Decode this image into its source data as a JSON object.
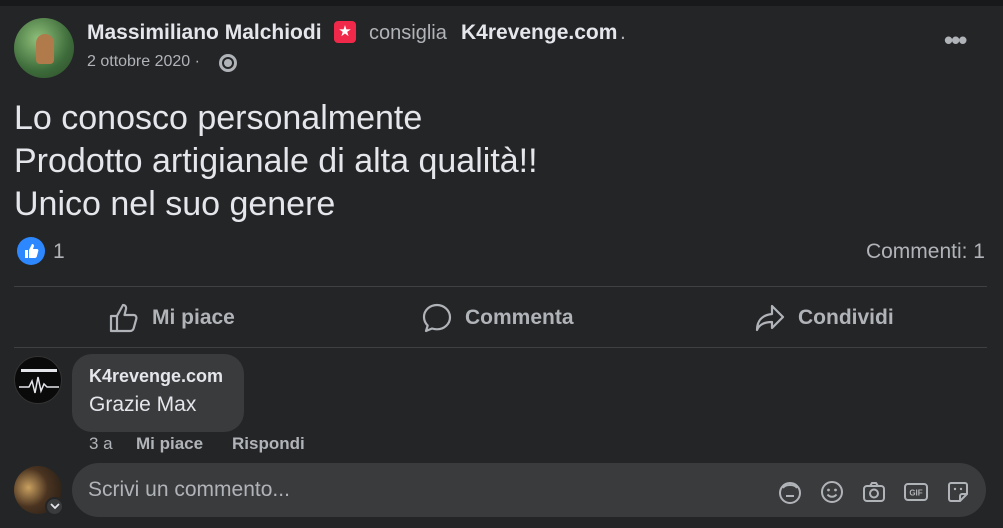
{
  "post": {
    "author": "Massimiliano Malchiodi",
    "badge_icon": "star-badge-icon",
    "recommends_label": "consiglia",
    "page_name": "K4revenge.com",
    "page_suffix": ".",
    "date": "2 ottobre 2020 ·",
    "privacy_icon": "globe-icon",
    "more_label": "•••",
    "text_lines": [
      "Lo conosco personalmente",
      "Prodotto artigianale di alta qualità!!",
      "Unico nel suo genere"
    ],
    "like_count": "1",
    "comments_count": "Commenti: 1"
  },
  "actions": {
    "like": "Mi piace",
    "comment": "Commenta",
    "share": "Condividi"
  },
  "comment": {
    "author": "K4revenge.com",
    "text": "Grazie Max",
    "age": "3 a",
    "like_label": "Mi piace",
    "reply_label": "Rispondi"
  },
  "composer": {
    "placeholder": "Scrivi un commento..."
  },
  "colors": {
    "background": "#18191a",
    "card": "#242526",
    "bubble": "#3a3b3c",
    "text_primary": "#e4e6eb",
    "text_secondary": "#b0b3b8",
    "like_blue": "#2d88ff",
    "badge_red": "#f02849"
  }
}
